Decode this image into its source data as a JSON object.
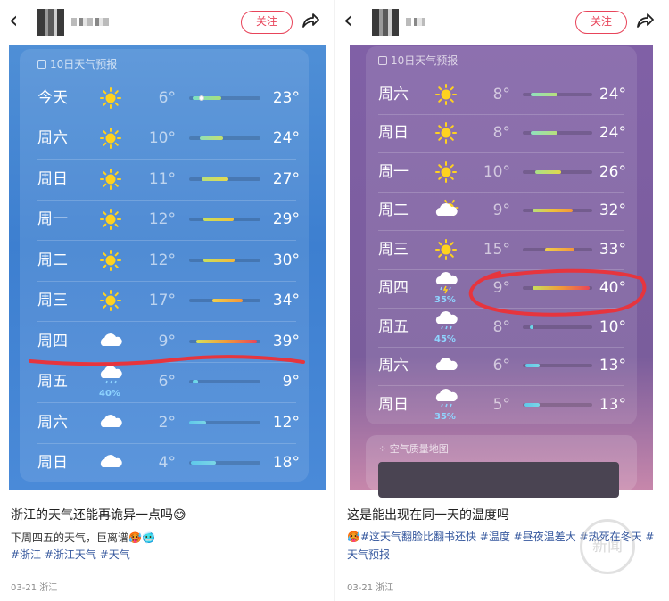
{
  "left": {
    "follow_label": "关注",
    "panel_header": "10日天气预报",
    "rows": [
      {
        "day": "今天",
        "icon": "sun-icon",
        "pct": "",
        "lo": "6°",
        "hi": "23°",
        "range": [
          0.05,
          0.45
        ],
        "current": 0.18,
        "colors": [
          "#7be0c6",
          "#a9e07a"
        ]
      },
      {
        "day": "周六",
        "icon": "sun-icon",
        "pct": "",
        "lo": "10°",
        "hi": "24°",
        "range": [
          0.15,
          0.48
        ],
        "colors": [
          "#8fe0b8",
          "#c5e06c"
        ]
      },
      {
        "day": "周日",
        "icon": "sun-icon",
        "pct": "",
        "lo": "11°",
        "hi": "27°",
        "range": [
          0.18,
          0.55
        ],
        "colors": [
          "#b7e07a",
          "#e6d94e"
        ]
      },
      {
        "day": "周一",
        "icon": "sun-icon",
        "pct": "",
        "lo": "12°",
        "hi": "29°",
        "range": [
          0.2,
          0.62
        ],
        "colors": [
          "#c9e05c",
          "#f1c23a"
        ]
      },
      {
        "day": "周二",
        "icon": "sun-icon",
        "pct": "",
        "lo": "12°",
        "hi": "30°",
        "range": [
          0.2,
          0.64
        ],
        "colors": [
          "#c9e05c",
          "#f4b83a"
        ]
      },
      {
        "day": "周三",
        "icon": "sun-icon",
        "pct": "",
        "lo": "17°",
        "hi": "34°",
        "range": [
          0.33,
          0.75
        ],
        "colors": [
          "#f1d04a",
          "#f4953a"
        ]
      },
      {
        "day": "周四",
        "icon": "cloud-icon",
        "pct": "",
        "lo": "9°",
        "hi": "39°",
        "range": [
          0.1,
          0.95
        ],
        "colors": [
          "#d7e25a",
          "#f09a3a",
          "#e8465a"
        ]
      },
      {
        "day": "周五",
        "icon": "rain-cloud-icon",
        "pct": "40%",
        "lo": "6°",
        "hi": "9°",
        "range": [
          0.05,
          0.12
        ],
        "colors": [
          "#5fd0e8",
          "#7adbe8"
        ]
      },
      {
        "day": "周六",
        "icon": "cloud-icon",
        "pct": "",
        "lo": "2°",
        "hi": "12°",
        "range": [
          0.0,
          0.24
        ],
        "colors": [
          "#5fc8ea",
          "#7ad6e6"
        ]
      },
      {
        "day": "周日",
        "icon": "cloud-icon",
        "pct": "",
        "lo": "4°",
        "hi": "18°",
        "range": [
          0.03,
          0.38
        ],
        "colors": [
          "#5fc8ea",
          "#7ad6e6"
        ]
      }
    ],
    "caption": "浙江的天气还能再诡异一点吗😅",
    "subtitle": "下周四五的天气，巨离谱🥵🥶",
    "tags": "#浙江 #浙江天气 #天气",
    "date": "03-21 浙江"
  },
  "right": {
    "follow_label": "关注",
    "panel_header": "10日天气预报",
    "rows": [
      {
        "day": "周六",
        "icon": "sun-icon",
        "pct": "",
        "lo": "8°",
        "hi": "24°",
        "range": [
          0.12,
          0.5
        ],
        "colors": [
          "#8fe0c0",
          "#b8e07a"
        ]
      },
      {
        "day": "周日",
        "icon": "sun-icon",
        "pct": "",
        "lo": "8°",
        "hi": "24°",
        "range": [
          0.12,
          0.5
        ],
        "colors": [
          "#8fe0c0",
          "#b8e07a"
        ]
      },
      {
        "day": "周一",
        "icon": "sun-icon",
        "pct": "",
        "lo": "10°",
        "hi": "26°",
        "range": [
          0.18,
          0.55
        ],
        "colors": [
          "#a8e08a",
          "#e2d84a"
        ]
      },
      {
        "day": "周二",
        "icon": "partly-cloudy-icon",
        "pct": "",
        "lo": "9°",
        "hi": "32°",
        "range": [
          0.14,
          0.72
        ],
        "colors": [
          "#b7e07a",
          "#f0c03a",
          "#f4953a"
        ]
      },
      {
        "day": "周三",
        "icon": "sun-icon",
        "pct": "",
        "lo": "15°",
        "hi": "33°",
        "range": [
          0.32,
          0.75
        ],
        "colors": [
          "#f0d04a",
          "#f4953a"
        ]
      },
      {
        "day": "周四",
        "icon": "thunder-rain-icon",
        "pct": "35%",
        "lo": "9°",
        "hi": "40°",
        "range": [
          0.14,
          0.96
        ],
        "colors": [
          "#c8e05c",
          "#f09a3a",
          "#e8465a"
        ]
      },
      {
        "day": "周五",
        "icon": "rain-cloud-icon",
        "pct": "45%",
        "lo": "8°",
        "hi": "10°",
        "range": [
          0.1,
          0.15
        ],
        "colors": [
          "#5fd0e8",
          "#7adbe8"
        ]
      },
      {
        "day": "周六",
        "icon": "cloud-icon",
        "pct": "",
        "lo": "6°",
        "hi": "13°",
        "range": [
          0.04,
          0.24
        ],
        "colors": [
          "#5fc8ea",
          "#7ad6e6"
        ]
      },
      {
        "day": "周日",
        "icon": "rain-cloud-icon",
        "pct": "35%",
        "lo": "5°",
        "hi": "13°",
        "range": [
          0.02,
          0.24
        ],
        "colors": [
          "#5fc8ea",
          "#7ad6e6"
        ]
      }
    ],
    "air_quality_title": "空气质量地图",
    "caption": "这是能出现在同一天的温度吗",
    "tags": "🥵#这天气翻脸比翻书还快 #温度 #昼夜温差大 #热死在冬天 #天气预报",
    "date": "03-21 浙江"
  },
  "watermark": "新闻",
  "colors": {
    "accent": "#e8445a",
    "link": "#36589e",
    "annotation": "#e6353e"
  }
}
